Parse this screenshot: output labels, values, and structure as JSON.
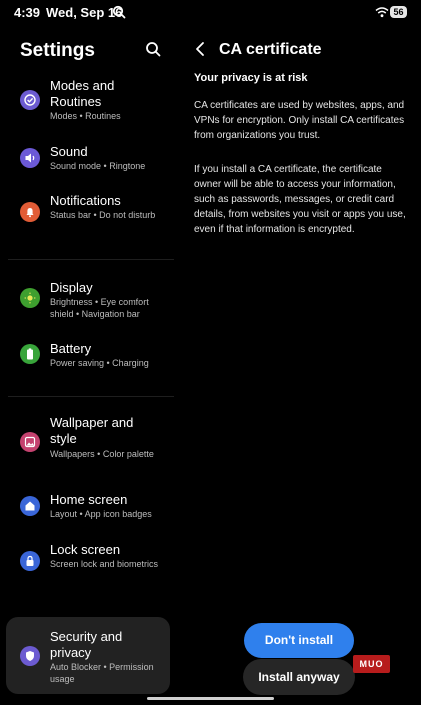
{
  "status_bar": {
    "time": "4:39",
    "date": "Wed, Sep 16",
    "battery": "56"
  },
  "settings": {
    "title": "Settings",
    "items": [
      {
        "title": "Modes and Routines",
        "subtitle": "Modes  •  Routines",
        "icon": "modes-icon",
        "color": "#6c5bd1"
      },
      {
        "title": "Sound",
        "subtitle": "Sound mode  •  Ringtone",
        "icon": "sound-icon",
        "color": "#6b59d6"
      },
      {
        "title": "Notifications",
        "subtitle": "Status bar  •  Do not disturb",
        "icon": "bell-icon",
        "color": "#e15c36"
      },
      {
        "title": "Display",
        "subtitle": "Brightness  •  Eye comfort shield  •  Navigation bar",
        "icon": "brightness-icon",
        "color": "#3e9f2f"
      },
      {
        "title": "Battery",
        "subtitle": "Power saving  •  Charging",
        "icon": "battery-icon",
        "color": "#38a43a"
      },
      {
        "title": "Wallpaper and style",
        "subtitle": "Wallpapers  •  Color palette",
        "icon": "wallpaper-icon",
        "color": "#c4426f"
      },
      {
        "title": "Home screen",
        "subtitle": "Layout  •  App icon badges",
        "icon": "home-icon",
        "color": "#3a66d8"
      },
      {
        "title": "Lock screen",
        "subtitle": "Screen lock and biometrics",
        "icon": "lock-icon",
        "color": "#3a66d8"
      },
      {
        "title": "Security and privacy",
        "subtitle": "Auto Blocker  •  Permission usage",
        "icon": "shield-icon",
        "color": "#6c5bd1"
      }
    ]
  },
  "ca_page": {
    "title": "CA certificate",
    "heading": "Your privacy is at risk",
    "paragraph1": "CA certificates are used by websites, apps, and VPNs for encryption. Only install CA certificates from organizations you trust.",
    "paragraph2": "If you install a CA certificate, the certificate owner will be able to access your information, such as passwords, messages, or credit card details, from websites you visit or apps you use, even if that information is encrypted.",
    "primary_button": "Don't install",
    "secondary_button": "Install anyway"
  },
  "watermark": "MUO"
}
